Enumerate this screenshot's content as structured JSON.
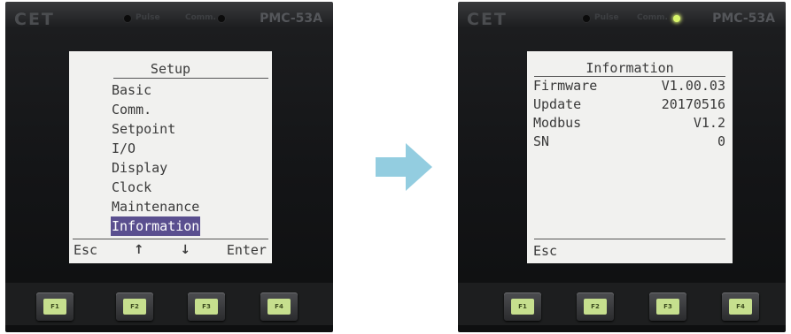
{
  "left_meter": {
    "brand": "CET",
    "model": "PMC-53A",
    "led_pulse_label": "Pulse",
    "led_comm_label": "Comm.",
    "screen": {
      "title": "Setup",
      "menu_items": [
        "Basic",
        "Comm.",
        "Setpoint",
        "I/O",
        "Display",
        "Clock",
        "Maintenance",
        "Information"
      ],
      "selected_item": "Information",
      "softkeys": {
        "f1": "Esc",
        "f2": "↑",
        "f3": "↓",
        "f4": "Enter"
      }
    },
    "keys": [
      "F1",
      "F2",
      "F3",
      "F4"
    ]
  },
  "right_meter": {
    "brand": "CET",
    "model": "PMC-53A",
    "led_pulse_label": "Pulse",
    "led_comm_label": "Comm.",
    "comm_led_on": true,
    "screen": {
      "title": "Information",
      "rows": [
        {
          "label": "Firmware",
          "value": "V1.00.03"
        },
        {
          "label": "Update",
          "value": "20170516"
        },
        {
          "label": "Modbus",
          "value": "V1.2"
        },
        {
          "label": "SN",
          "value": "0"
        }
      ],
      "softkeys": {
        "f1": "Esc"
      }
    },
    "keys": [
      "F1",
      "F2",
      "F3",
      "F4"
    ]
  },
  "colors": {
    "lcd_background": "#f1f1ef",
    "selection_highlight": "#5a4f8f",
    "arrow": "#93cde0",
    "key_cap": "#c6df8e"
  },
  "icons": {
    "transition": "arrow-right-icon"
  }
}
